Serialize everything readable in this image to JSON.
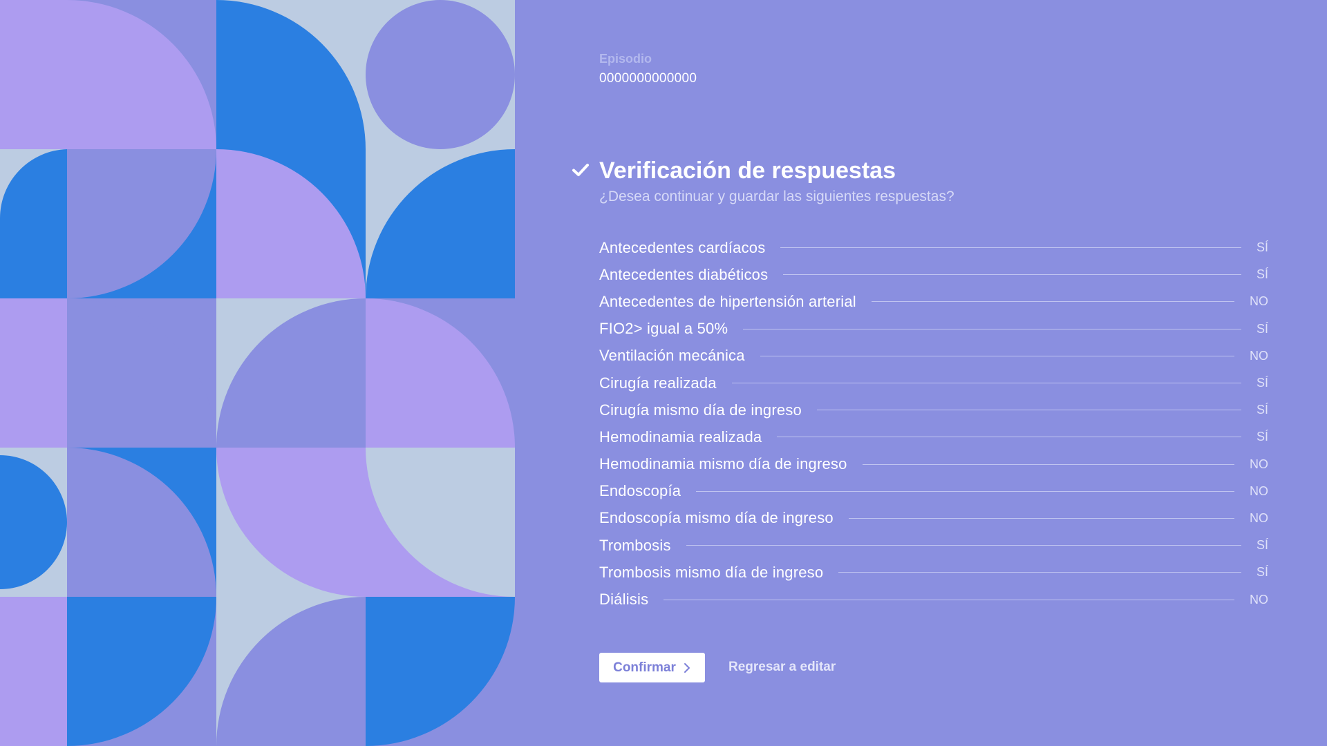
{
  "colors": {
    "background": "#8a8fe0",
    "pattern_light_purple": "#ad9cf0",
    "pattern_periwinkle": "#8a8fe0",
    "pattern_blue": "#2b7fe1",
    "pattern_pale_blue": "#bccce2",
    "text_primary": "#ffffff",
    "text_muted": "#b3b8ee",
    "button_text": "#7c80d8"
  },
  "episode": {
    "label": "Episodio",
    "value": "0000000000000"
  },
  "header": {
    "icon": "check-icon",
    "title": "Verificación de respuestas",
    "subtitle": "¿Desea continuar y guardar las siguientes respuestas?"
  },
  "answers": [
    {
      "question": "Antecedentes cardíacos",
      "answer": "SÍ"
    },
    {
      "question": "Antecedentes diabéticos",
      "answer": "SÍ"
    },
    {
      "question": "Antecedentes de hipertensión arterial",
      "answer": "NO"
    },
    {
      "question": "FIO2> igual a 50%",
      "answer": "SÍ"
    },
    {
      "question": "Ventilación mecánica",
      "answer": "NO"
    },
    {
      "question": "Cirugía realizada",
      "answer": "SÍ"
    },
    {
      "question": "Cirugía mismo día de ingreso",
      "answer": "SÍ"
    },
    {
      "question": "Hemodinamia realizada",
      "answer": "SÍ"
    },
    {
      "question": "Hemodinamia mismo día de ingreso",
      "answer": "NO"
    },
    {
      "question": "Endoscopía",
      "answer": "NO"
    },
    {
      "question": "Endoscopía mismo día de ingreso",
      "answer": "NO"
    },
    {
      "question": "Trombosis",
      "answer": "SÍ"
    },
    {
      "question": "Trombosis mismo día de ingreso",
      "answer": "SÍ"
    },
    {
      "question": "Diálisis",
      "answer": "NO"
    }
  ],
  "actions": {
    "confirm_label": "Confirmar",
    "confirm_icon": "chevron-right-icon",
    "back_label": "Regresar a editar"
  }
}
